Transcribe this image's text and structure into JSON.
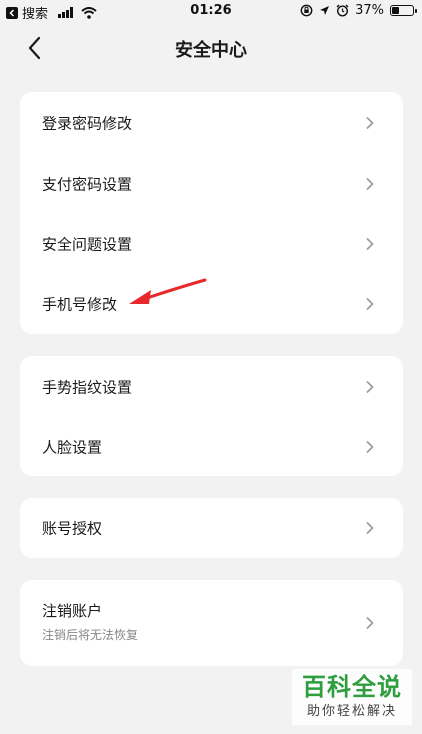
{
  "status_bar": {
    "back_label": "搜索",
    "time": "01:26",
    "battery_percent": "37%",
    "battery_level": 0.37
  },
  "nav": {
    "title": "安全中心"
  },
  "groups": [
    {
      "items": [
        {
          "label": "登录密码修改"
        },
        {
          "label": "支付密码设置"
        },
        {
          "label": "安全问题设置"
        },
        {
          "label": "手机号修改"
        }
      ]
    },
    {
      "items": [
        {
          "label": "手势指纹设置"
        },
        {
          "label": "人脸设置"
        }
      ]
    },
    {
      "items": [
        {
          "label": "账号授权"
        }
      ]
    },
    {
      "items": [
        {
          "label": "注销账户",
          "sublabel": "注销后将无法恢复"
        }
      ]
    }
  ],
  "watermark": {
    "main": "百科全说",
    "sub": "助你轻松解决"
  },
  "colors": {
    "background": "#f2f2f2",
    "card": "#ffffff",
    "annotation_arrow": "#e8282b",
    "watermark_green": "#2e9e3e"
  }
}
